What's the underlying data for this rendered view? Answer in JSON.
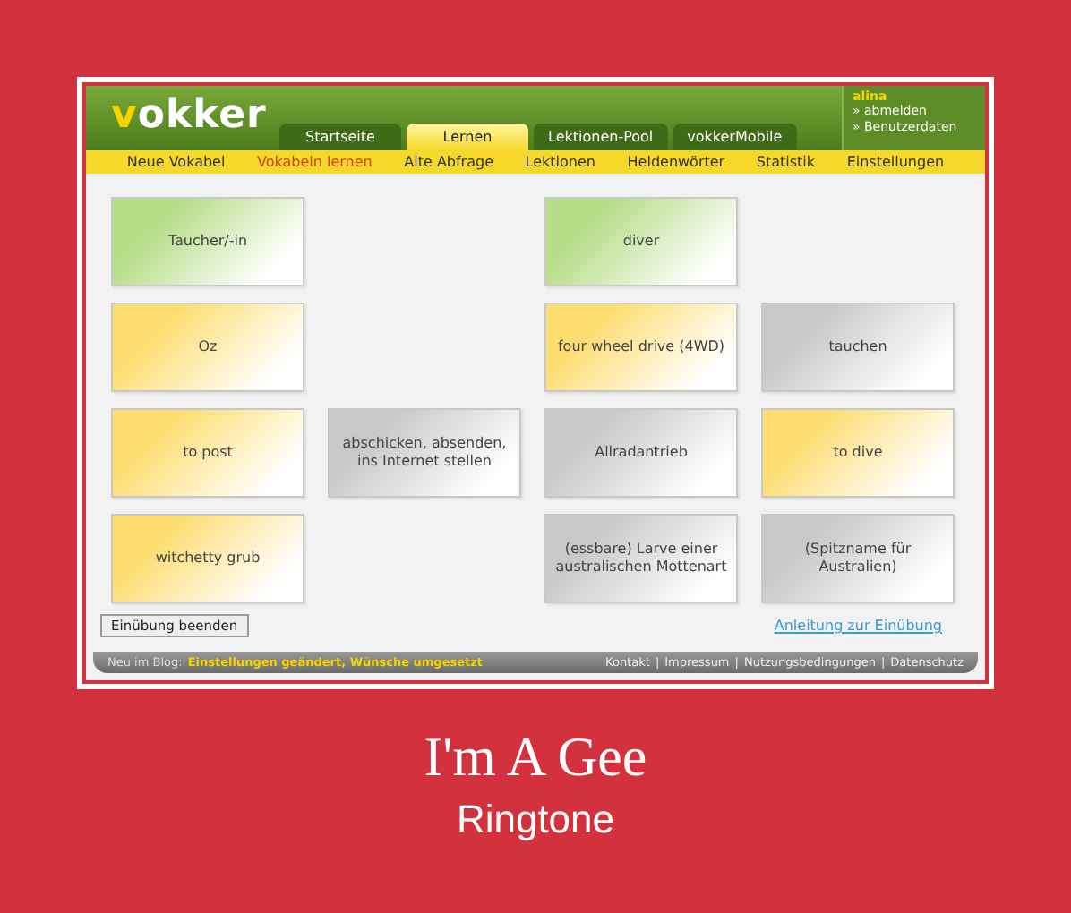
{
  "header": {
    "logo": "vokker",
    "tabs": [
      {
        "label": "Startseite",
        "selected": false
      },
      {
        "label": "Lernen",
        "selected": true
      },
      {
        "label": "Lektionen-Pool",
        "selected": false
      },
      {
        "label": "vokkerMobile",
        "selected": false
      }
    ],
    "user": {
      "name": "alina",
      "links": [
        "» abmelden",
        "» Benutzerdaten"
      ]
    }
  },
  "subnav": [
    {
      "label": "Neue Vokabel",
      "selected": false
    },
    {
      "label": "Vokabeln lernen",
      "selected": true
    },
    {
      "label": "Alte Abfrage",
      "selected": false
    },
    {
      "label": "Lektionen",
      "selected": false
    },
    {
      "label": "Heldenwörter",
      "selected": false
    },
    {
      "label": "Statistik",
      "selected": false
    },
    {
      "label": "Einstellungen",
      "selected": false
    }
  ],
  "cards": [
    [
      {
        "kind": "card",
        "text": "Taucher/-in",
        "color": "#b5dc86"
      },
      {
        "kind": "empty"
      },
      {
        "kind": "card",
        "text": "diver",
        "color": "#b5dc86"
      },
      {
        "kind": "empty"
      }
    ],
    [
      {
        "kind": "card",
        "text": "Oz",
        "color": "#fddd70"
      },
      {
        "kind": "empty"
      },
      {
        "kind": "card",
        "text": "four wheel drive (4WD)",
        "color": "#fddd70"
      },
      {
        "kind": "card",
        "text": "tauchen",
        "color": "#c8c8c8"
      }
    ],
    [
      {
        "kind": "card",
        "text": "to post",
        "color": "#fddd70"
      },
      {
        "kind": "card",
        "text": "abschicken, absenden, ins Internet stellen",
        "color": "#c8c8c8"
      },
      {
        "kind": "card",
        "text": "Allradantrieb",
        "color": "#c8c8c8"
      },
      {
        "kind": "card",
        "text": "to dive",
        "color": "#fddd70"
      }
    ],
    [
      {
        "kind": "card",
        "text": "witchetty grub",
        "color": "#fddd70"
      },
      {
        "kind": "empty"
      },
      {
        "kind": "card",
        "text": "(essbare) Larve einer australischen Mottenart",
        "color": "#c8c8c8"
      },
      {
        "kind": "card",
        "text": "(Spitzname für Australien)",
        "color": "#c8c8c8"
      }
    ]
  ],
  "end_button": "Einübung beenden",
  "help_link": "Anleitung zur Einübung",
  "footer": {
    "blog_label": "Neu im Blog:",
    "blog_link": "Einstellungen geändert, Wünsche umgesetzt",
    "separator": "|",
    "links": [
      "Kontakt",
      "Impressum",
      "Nutzungsbedingungen",
      "Datenschutz"
    ]
  },
  "caption": {
    "title": "I'm A Gee",
    "subtitle": "Ringtone"
  }
}
